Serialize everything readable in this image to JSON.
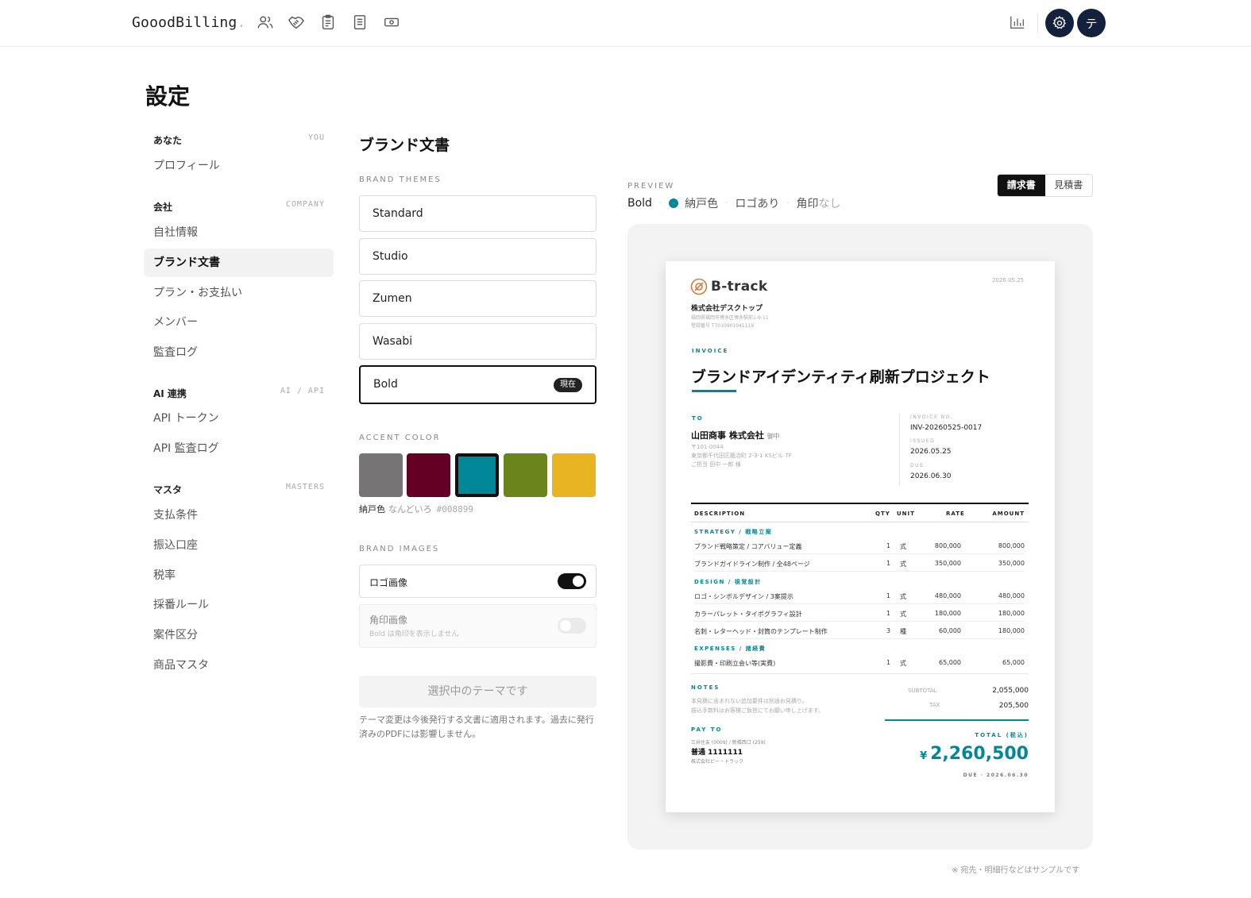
{
  "app": {
    "logo": "GooodBilling",
    "logo_dot": "."
  },
  "header": {
    "nav_icons": [
      "users-icon",
      "handshake-icon",
      "clipboard-icon",
      "document-icon",
      "cash-icon"
    ],
    "avatar_initial": "テ"
  },
  "page": {
    "title": "設定"
  },
  "sidebar": {
    "you": {
      "label": "あなた",
      "tag": "YOU",
      "items": [
        "プロフィール"
      ]
    },
    "company": {
      "label": "会社",
      "tag": "COMPANY",
      "items": [
        "自社情報",
        "ブランド文書",
        "プラン・お支払い",
        "メンバー",
        "監査ログ"
      ]
    },
    "ai": {
      "label": "AI 連携",
      "tag": "AI / API",
      "items": [
        "API トークン",
        "API 監査ログ"
      ]
    },
    "masters": {
      "label": "マスタ",
      "tag": "MASTERS",
      "items": [
        "支払条件",
        "振込口座",
        "税率",
        "採番ルール",
        "案件区分",
        "商品マスタ"
      ]
    }
  },
  "brand": {
    "title": "ブランド文書",
    "themes_label": "BRAND THEMES",
    "themes": [
      "Standard",
      "Studio",
      "Zumen",
      "Wasabi",
      "Bold"
    ],
    "current_badge": "現在",
    "accent_label": "ACCENT COLOR",
    "accent_colors": [
      "#767474",
      "#650025",
      "#008899",
      "#6a851b",
      "#e8b424"
    ],
    "selected_color": {
      "name": "納戸色",
      "reading": "なんどいろ",
      "hex": "#008899"
    },
    "images_label": "BRAND IMAGES",
    "logo_image": {
      "label": "ロゴ画像",
      "enabled": true
    },
    "seal_image": {
      "label": "角印画像",
      "hint": "Bold は角印を表示しません",
      "enabled": false
    },
    "apply_button": "選択中のテーマです",
    "note": "テーマ変更は今後発行する文書に適用されます。過去に発行済みのPDFには影響しません。"
  },
  "preview": {
    "label": "PREVIEW",
    "theme": "Bold",
    "color_name": "納戸色",
    "logo_state": "ロゴあり",
    "seal_label": "角印",
    "seal_state": "なし",
    "tabs": [
      "請求書",
      "見積書"
    ],
    "footnote": "※ 宛先・明細行などはサンプルです"
  },
  "invoice": {
    "brand": "B-track",
    "date": "2026.05.25",
    "company": "株式会社デスクトップ",
    "company_address": "福岡県福岡市博多区博多駅前1-9-11",
    "company_reg": "登録番号 T7010901041119",
    "doc_type": "INVOICE",
    "title": "ブランドアイデンティティ刷新プロジェクト",
    "to_label": "TO",
    "client": "山田商事 株式会社",
    "client_suffix": "御中",
    "client_zip": "〒101-0044",
    "client_address": "東京都千代田区鍛冶町 2-3-1 KSビル 7F",
    "client_contact": "ご担当 田中 一郎 様",
    "invoice_no_label": "INVOICE NO.",
    "invoice_no": "INV-20260525-0017",
    "issued_label": "ISSUED",
    "issued": "2026.05.25",
    "due_label": "DUE",
    "due": "2026.06.30",
    "columns": [
      "DESCRIPTION",
      "QTY",
      "UNIT",
      "RATE",
      "AMOUNT"
    ],
    "sections": [
      {
        "name": "STRATEGY / 戦略立案",
        "rows": [
          [
            "ブランド戦略策定 / コアバリュー定義",
            "1",
            "式",
            "800,000",
            "800,000"
          ],
          [
            "ブランドガイドライン制作 / 全48ページ",
            "1",
            "式",
            "350,000",
            "350,000"
          ]
        ]
      },
      {
        "name": "DESIGN / 視覚設計",
        "rows": [
          [
            "ロゴ・シンボルデザイン / 3案提示",
            "1",
            "式",
            "480,000",
            "480,000"
          ],
          [
            "カラーパレット・タイポグラフィ設計",
            "1",
            "式",
            "180,000",
            "180,000"
          ],
          [
            "名刺・レターヘッド・封筒のテンプレート制作",
            "3",
            "種",
            "60,000",
            "180,000"
          ]
        ]
      },
      {
        "name": "EXPENSES / 諸経費",
        "rows": [
          [
            "撮影費・印刷立会い等(実費)",
            "1",
            "式",
            "65,000",
            "65,000"
          ]
        ]
      }
    ],
    "notes_label": "NOTES",
    "notes_1": "本見積に含まれない追加要件は別途お見積り。",
    "notes_2": "振込手数料はお客様ご負担にてお願い申し上げます。",
    "subtotal_label": "SUBTOTAL",
    "subtotal": "2,055,000",
    "tax_label": "TAX",
    "tax": "205,500",
    "total_label": "TOTAL (税込)",
    "currency": "¥",
    "total": "2,260,500",
    "due_footer": "DUE · 2026.06.30",
    "payto_label": "PAY TO",
    "bank": "三井住友 (0009) / 新橋西口 (259)",
    "account": "普通 1111111",
    "account_name": "株式会社ビー・トラック"
  }
}
